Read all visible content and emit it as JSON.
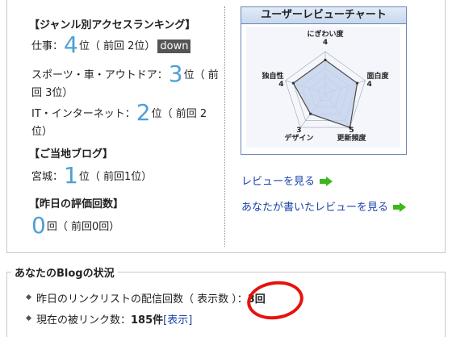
{
  "ranking": {
    "title": "【ジャンル別アクセスランキング】",
    "work": {
      "label": "仕事：",
      "rank": "4",
      "unit": "位",
      "prev": "（ 前回 2位）",
      "badge": "down"
    },
    "sports": {
      "label": "スポーツ・車・アウトドア：",
      "rank": "3",
      "unit": "位（ 前",
      "prev_line2": "回 3位）"
    },
    "it": {
      "label": "IT・インターネット：",
      "rank": "2",
      "unit": "位（ 前回 2",
      "prev_line2": "位）"
    }
  },
  "local": {
    "title": "【ご当地ブログ】",
    "label": "宮城：",
    "rank": "1",
    "unit": "位",
    "prev": "（ 前回1位）"
  },
  "yesterday": {
    "title": "【昨日の評価回数】",
    "count": "0",
    "unit": "回",
    "prev": "（ 前回0回）"
  },
  "review_chart": {
    "title": "ユーザーレビューチャート"
  },
  "chart_data": {
    "type": "radar",
    "axes": [
      "にぎわい度",
      "面白度",
      "更新頻度",
      "デザイン",
      "独自性"
    ],
    "values": [
      4,
      4,
      5,
      3,
      4
    ],
    "max": 5
  },
  "links": {
    "see_review": "レビューを見る",
    "your_review": "あなたが書いたレビューを見る"
  },
  "status": {
    "title": "あなたのBlogの状況",
    "item1_label": "昨日のリンクリストの配信回数（ 表示数 ）：",
    "item1_value": "3回",
    "item2_label": "現在の被リンク数：",
    "item2_value": "185件",
    "item2_link": "[表示]"
  },
  "colors": {
    "accent_number": "#4d9fd6",
    "link": "#1a44a8",
    "arrow": "#3cb81c",
    "annotation": "#e6120e"
  }
}
